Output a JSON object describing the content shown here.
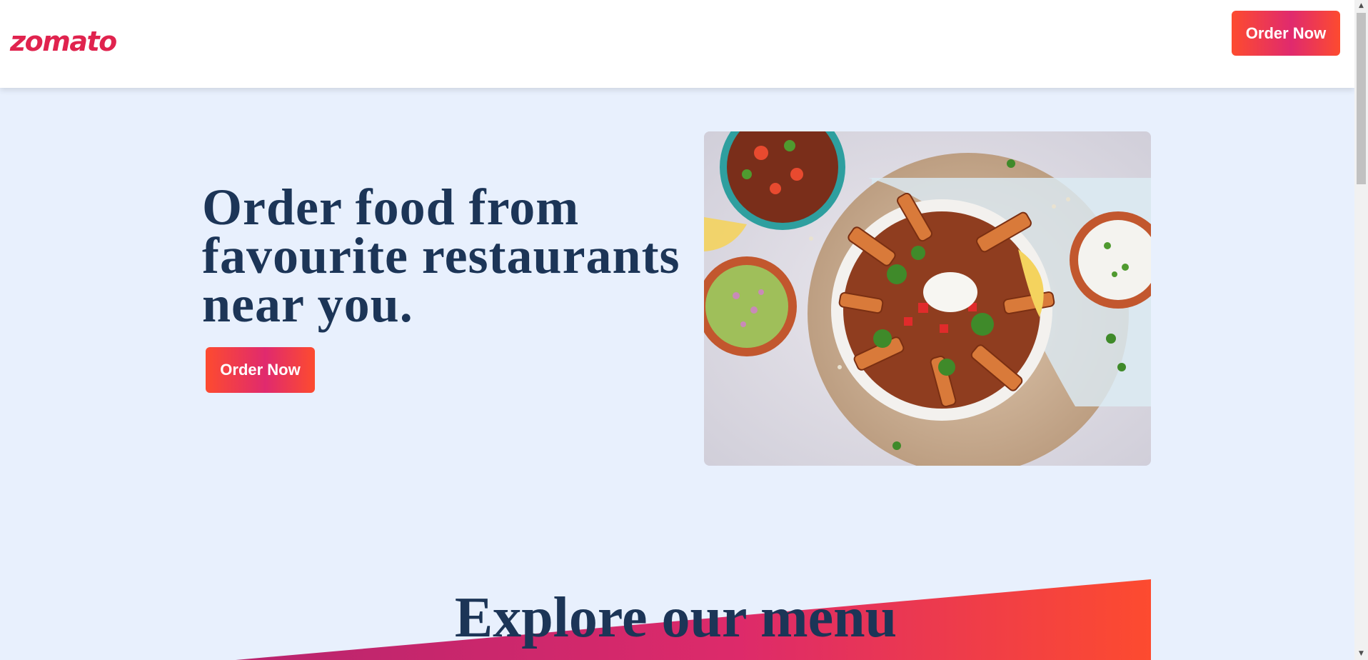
{
  "header": {
    "logo_text": "zomato",
    "order_button_label": "Order Now"
  },
  "hero": {
    "title": "Order food from favourite restaurants near you.",
    "order_button_label": "Order Now",
    "image_icon": "food-bowl-photo"
  },
  "explore": {
    "title": "Explore our menu"
  },
  "colors": {
    "brand_red": "#e0234e",
    "gradient_start": "#fd4b2f",
    "gradient_mid": "#e02a6e",
    "heading": "#1c3557",
    "page_bg": "#e8f0fd"
  },
  "scrollbar": {
    "up_icon": "arrow-up-icon",
    "down_icon": "arrow-down-icon"
  }
}
